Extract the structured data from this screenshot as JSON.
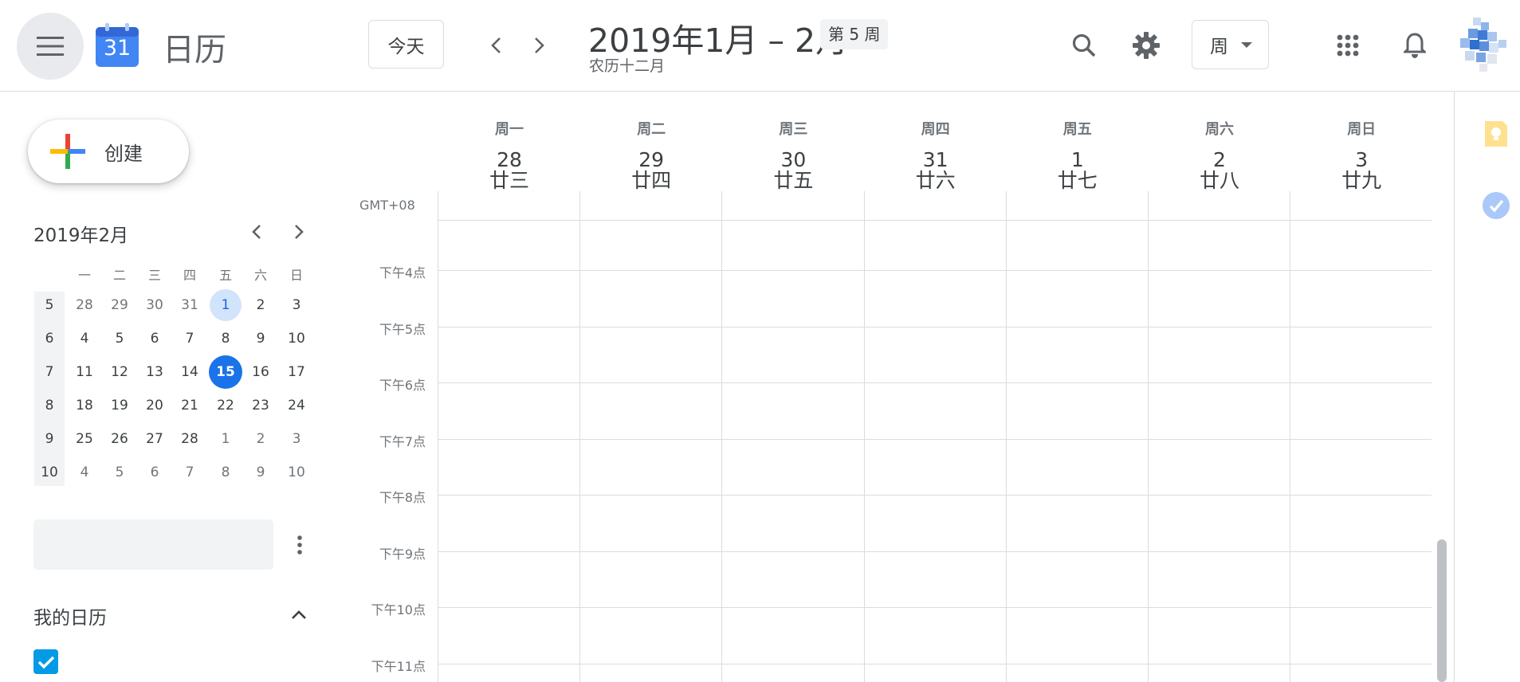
{
  "header": {
    "app_title": "日历",
    "logo_day": "31",
    "today_label": "今天",
    "date_range": "2019年1月 – 2月",
    "week_badge": "第 5 周",
    "lunar_month": "农历十二月",
    "view_label": "周"
  },
  "sidebar": {
    "create_label": "创建",
    "mini_month_title": "2019年2月",
    "dow": [
      "一",
      "二",
      "三",
      "四",
      "五",
      "六",
      "日"
    ],
    "weeks": [
      {
        "wk": "5",
        "days": [
          "28",
          "29",
          "30",
          "31",
          "1",
          "2",
          "3"
        ]
      },
      {
        "wk": "6",
        "days": [
          "4",
          "5",
          "6",
          "7",
          "8",
          "9",
          "10"
        ]
      },
      {
        "wk": "7",
        "days": [
          "11",
          "12",
          "13",
          "14",
          "15",
          "16",
          "17"
        ]
      },
      {
        "wk": "8",
        "days": [
          "18",
          "19",
          "20",
          "21",
          "22",
          "23",
          "24"
        ]
      },
      {
        "wk": "9",
        "days": [
          "25",
          "26",
          "27",
          "28",
          "1",
          "2",
          "3"
        ]
      },
      {
        "wk": "10",
        "days": [
          "4",
          "5",
          "6",
          "7",
          "8",
          "9",
          "10"
        ]
      }
    ],
    "my_calendars_title": "我的日历"
  },
  "week_view": {
    "timezone": "GMT+08",
    "days": [
      {
        "dow": "周一",
        "date": "28",
        "lunar": "廿三"
      },
      {
        "dow": "周二",
        "date": "29",
        "lunar": "廿四"
      },
      {
        "dow": "周三",
        "date": "30",
        "lunar": "廿五"
      },
      {
        "dow": "周四",
        "date": "31",
        "lunar": "廿六"
      },
      {
        "dow": "周五",
        "date": "1",
        "lunar": "廿七"
      },
      {
        "dow": "周六",
        "date": "2",
        "lunar": "廿八"
      },
      {
        "dow": "周日",
        "date": "3",
        "lunar": "廿九"
      }
    ],
    "hours": [
      "下午4点",
      "下午5点",
      "下午6点",
      "下午7点",
      "下午8点",
      "下午9点",
      "下午10点",
      "下午11点"
    ]
  },
  "colors": {
    "accent": "#1a73e8",
    "selected_bg": "#d2e3fc",
    "checkbox": "#039be5",
    "grid_line": "#dadce0"
  },
  "icons": {
    "menu": "hamburger-menu-icon",
    "search": "search-icon",
    "settings": "gear-icon",
    "apps": "apps-grid-icon",
    "notifications": "bell-icon",
    "keep": "keep-bulb-icon",
    "tasks": "tasks-icon"
  }
}
